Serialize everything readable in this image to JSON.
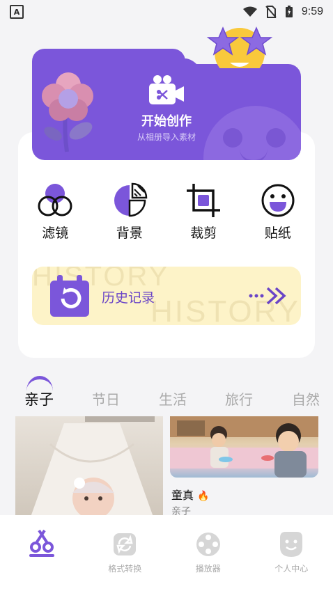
{
  "status_bar": {
    "time": "9:59",
    "left_icon": "A"
  },
  "create": {
    "title": "开始创作",
    "subtitle": "从相册导入素材"
  },
  "tools": [
    {
      "label": "滤镜",
      "icon": "filter-icon"
    },
    {
      "label": "背景",
      "icon": "background-icon"
    },
    {
      "label": "裁剪",
      "icon": "crop-icon"
    },
    {
      "label": "贴纸",
      "icon": "sticker-icon"
    }
  ],
  "history": {
    "label": "历史记录",
    "watermark_top": "HISTORY",
    "watermark_bottom": "HISTORY"
  },
  "categories": [
    "亲子",
    "节日",
    "生活",
    "旅行",
    "自然"
  ],
  "active_category": "亲子",
  "photos": [
    {
      "title": "",
      "tag": ""
    },
    {
      "title": "童真",
      "tag": "亲子",
      "emoji": "🔥"
    }
  ],
  "nav": [
    {
      "label": "",
      "icon": "video-edit-icon",
      "active": true
    },
    {
      "label": "格式转换",
      "icon": "format-convert-icon"
    },
    {
      "label": "播放器",
      "icon": "player-icon"
    },
    {
      "label": "个人中心",
      "icon": "profile-icon"
    }
  ],
  "colors": {
    "accent": "#7b56da",
    "history_bg": "#fdf3c8",
    "bg": "#f4f4f6"
  }
}
